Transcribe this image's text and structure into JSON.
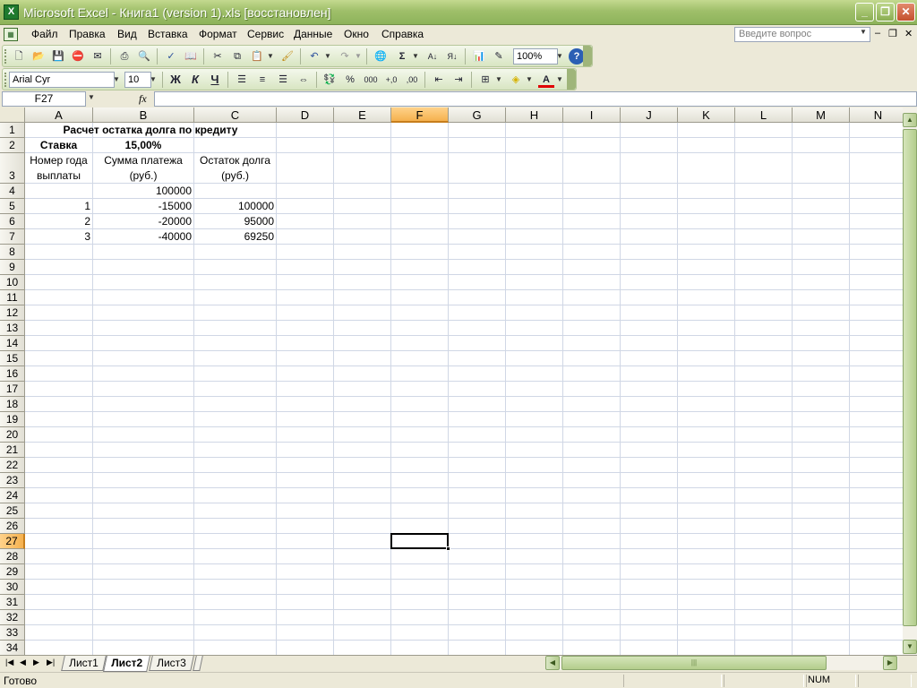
{
  "window": {
    "title": "Microsoft Excel - Книга1 (version 1).xls  [восстановлен]",
    "app_icon": "excel-icon",
    "minimize": "_",
    "maximize": "❐",
    "close": "✕"
  },
  "menu": {
    "items": [
      "Файл",
      "Правка",
      "Вид",
      "Вставка",
      "Формат",
      "Сервис",
      "Данные",
      "Окно",
      "Справка"
    ],
    "ask_placeholder": "Введите вопрос",
    "mdi_min": "–",
    "mdi_restore": "❐",
    "mdi_close": "✕"
  },
  "toolbar_standard": {
    "zoom": "100%",
    "autosum_label": "Σ"
  },
  "toolbar_formatting": {
    "font_name": "Arial Cyr",
    "font_size": "10",
    "bold_label": "Ж",
    "italic_label": "К",
    "underline_label": "Ч",
    "percent_label": "%",
    "thousands_label": "000",
    "inc_decimal_label": "+,0",
    "dec_decimal_label": ",00"
  },
  "formula_bar": {
    "name_box": "F27",
    "fx_label": "fx",
    "formula": ""
  },
  "sheet": {
    "columns": [
      "A",
      "B",
      "C",
      "D",
      "E",
      "F",
      "G",
      "H",
      "I",
      "J",
      "K",
      "L",
      "M",
      "N"
    ],
    "selected_column": "F",
    "rows": [
      "1",
      "2",
      "3",
      "4",
      "5",
      "6",
      "7",
      "8",
      "9",
      "10",
      "11",
      "12",
      "13",
      "14",
      "15",
      "16",
      "17",
      "18",
      "19",
      "20",
      "21",
      "22",
      "23",
      "24",
      "25",
      "26",
      "27",
      "28",
      "29",
      "30",
      "31",
      "32",
      "33",
      "34"
    ],
    "selected_row": "27",
    "cells": {
      "A1": "Расчет остатка долга по кредиту",
      "A2": "Ставка",
      "B2": "15,00%",
      "A3": "Номер года выплаты",
      "B3": "Сумма платежа (руб.)",
      "C3": "Остаток долга (руб.)",
      "B4": "100000",
      "A5": "1",
      "B5": "-15000",
      "C5": "100000",
      "A6": "2",
      "B6": "-20000",
      "C6": "95000",
      "A7": "3",
      "B7": "-40000",
      "C7": "69250"
    }
  },
  "tabs": {
    "sheets": [
      "Лист1",
      "Лист2",
      "Лист3"
    ],
    "active": "Лист2"
  },
  "status": {
    "text": "Готово",
    "num": "NUM"
  }
}
